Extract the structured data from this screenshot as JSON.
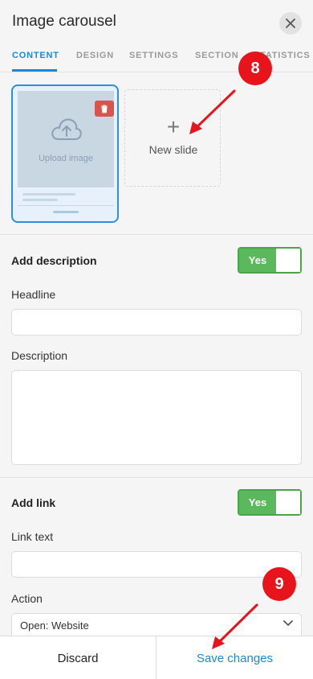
{
  "header": {
    "title": "Image carousel"
  },
  "tabs": [
    {
      "label": "CONTENT"
    },
    {
      "label": "DESIGN"
    },
    {
      "label": "SETTINGS"
    },
    {
      "label": "SECTION"
    },
    {
      "label": "STATISTICS"
    }
  ],
  "slides": {
    "upload_label": "Upload image",
    "new_slide_label": "New slide",
    "plus_glyph": "+"
  },
  "description": {
    "heading": "Add description",
    "toggle_label": "Yes",
    "headline_label": "Headline",
    "description_label": "Description"
  },
  "link": {
    "heading": "Add link",
    "toggle_label": "Yes",
    "link_text_label": "Link text",
    "action_label": "Action",
    "action_value": "Open: Website"
  },
  "footer": {
    "discard_label": "Discard",
    "save_label": "Save changes"
  },
  "annotations": {
    "badge_new_slide": "8",
    "badge_save": "9"
  },
  "colors": {
    "accent": "#1a88d8",
    "toggle_on": "#5cb85c",
    "delete": "#d9534f",
    "annotation": "#e8141b"
  }
}
